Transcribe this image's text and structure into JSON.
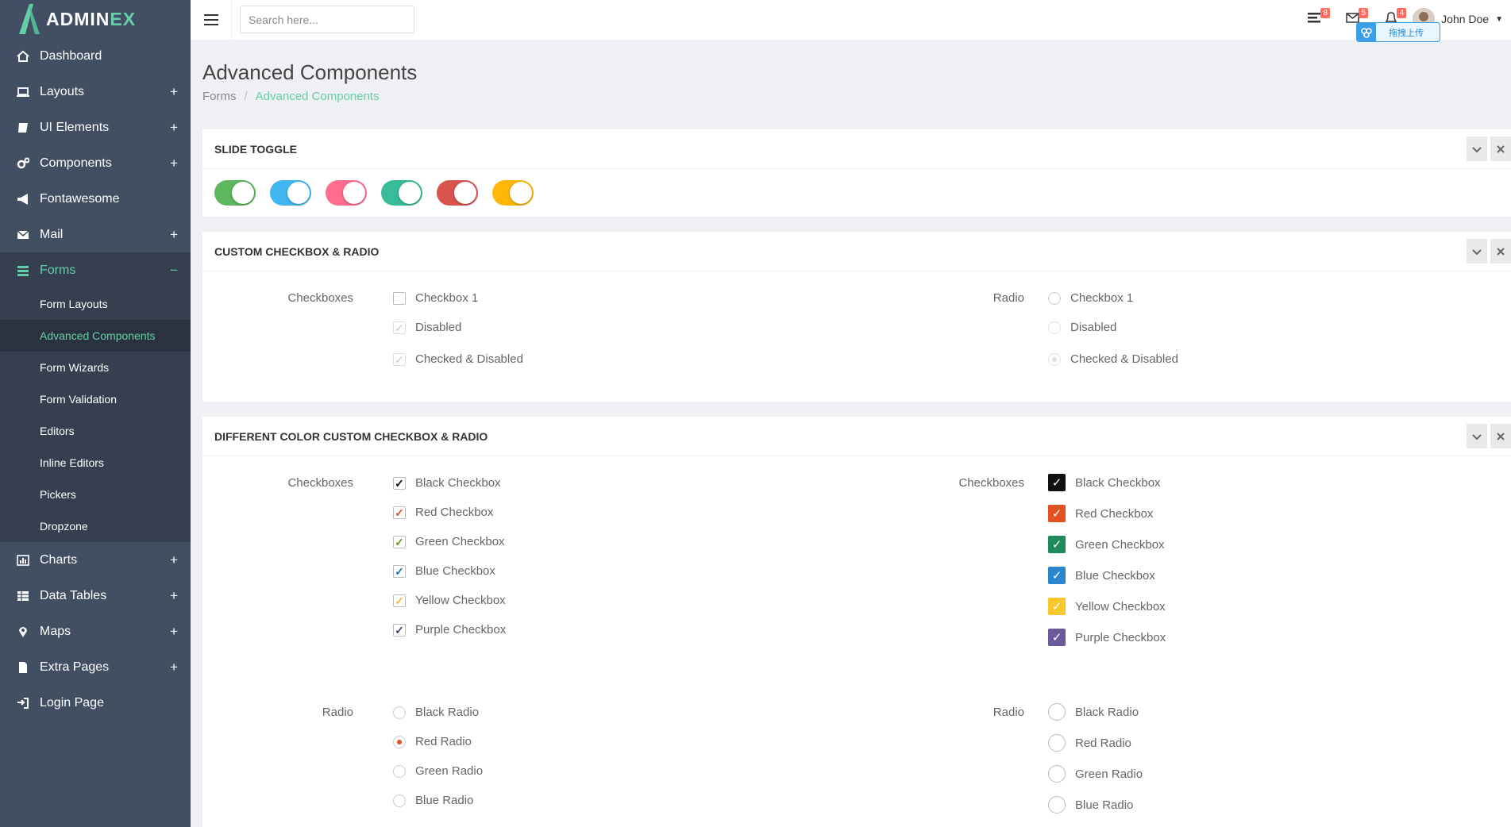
{
  "app": {
    "logo_text": "ADMIN",
    "logo_text_accent": "EX"
  },
  "sidebar": {
    "items": [
      {
        "label": "Dashboard",
        "icon": "home-icon",
        "expand": ""
      },
      {
        "label": "Layouts",
        "icon": "laptop-icon",
        "expand": "+"
      },
      {
        "label": "UI Elements",
        "icon": "book-icon",
        "expand": "+"
      },
      {
        "label": "Components",
        "icon": "cogs-icon",
        "expand": "+"
      },
      {
        "label": "Fontawesome",
        "icon": "bullhorn-icon",
        "expand": ""
      },
      {
        "label": "Mail",
        "icon": "envelope-icon",
        "expand": "+"
      },
      {
        "label": "Forms",
        "icon": "tasks-icon",
        "expand": "−"
      }
    ],
    "forms_sub": [
      {
        "label": "Form Layouts"
      },
      {
        "label": "Advanced Components"
      },
      {
        "label": "Form Wizards"
      },
      {
        "label": "Form Validation"
      },
      {
        "label": "Editors"
      },
      {
        "label": "Inline Editors"
      },
      {
        "label": "Pickers"
      },
      {
        "label": "Dropzone"
      }
    ],
    "items2": [
      {
        "label": "Charts",
        "icon": "bar-chart-icon",
        "expand": "+"
      },
      {
        "label": "Data Tables",
        "icon": "table-icon",
        "expand": "+"
      },
      {
        "label": "Maps",
        "icon": "map-marker-icon",
        "expand": "+"
      },
      {
        "label": "Extra Pages",
        "icon": "file-icon",
        "expand": "+"
      },
      {
        "label": "Login Page",
        "icon": "sign-in-icon",
        "expand": ""
      }
    ]
  },
  "header": {
    "search_placeholder": "Search here...",
    "badges": {
      "tasks": "8",
      "mail": "5",
      "notifications": "4"
    },
    "user_name": "John Doe",
    "upload_label": "拖拽上传"
  },
  "page": {
    "title": "Advanced Components",
    "breadcrumb": {
      "parent": "Forms",
      "separator": "/",
      "current": "Advanced Components"
    }
  },
  "panels": {
    "slide_toggle": {
      "title": "SLIDE TOGGLE",
      "toggle_colors": [
        "#5cb85c",
        "#41b6f0",
        "#ff6c8d",
        "#38bb99",
        "#d9534f",
        "#ffb606"
      ]
    },
    "custom": {
      "title": "CUSTOM CHECKBOX & RADIO",
      "checkbox_label": "Checkboxes",
      "checkboxes": [
        "Checkbox 1",
        "Disabled",
        "Checked & Disabled"
      ],
      "radio_label": "Radio",
      "radios": [
        "Checkbox 1",
        "Disabled",
        "Checked & Disabled"
      ]
    },
    "colors": {
      "title": "DIFFERENT COLOR CUSTOM CHECKBOX & RADIO",
      "checkbox_label": "Checkboxes",
      "radio_label": "Radio",
      "checkboxes": [
        "Black Checkbox",
        "Red Checkbox",
        "Green Checkbox",
        "Blue Checkbox",
        "Yellow Checkbox",
        "Purple Checkbox"
      ],
      "checkbox_colors": [
        "#111111",
        "#e2511f",
        "#1f8a5a",
        "#2b86d1",
        "#f9c82e",
        "#6a5a9a"
      ],
      "checkbox_tick_colors": [
        "#111111",
        "#e2511f",
        "#6aa01e",
        "#1f6fb5",
        "#f9b92e",
        "#4a3a7a"
      ],
      "radios_left": [
        "Black Radio",
        "Red Radio",
        "Green Radio",
        "Blue Radio"
      ],
      "radios_right": [
        "Black Radio",
        "Red Radio",
        "Green Radio",
        "Blue Radio"
      ]
    }
  }
}
